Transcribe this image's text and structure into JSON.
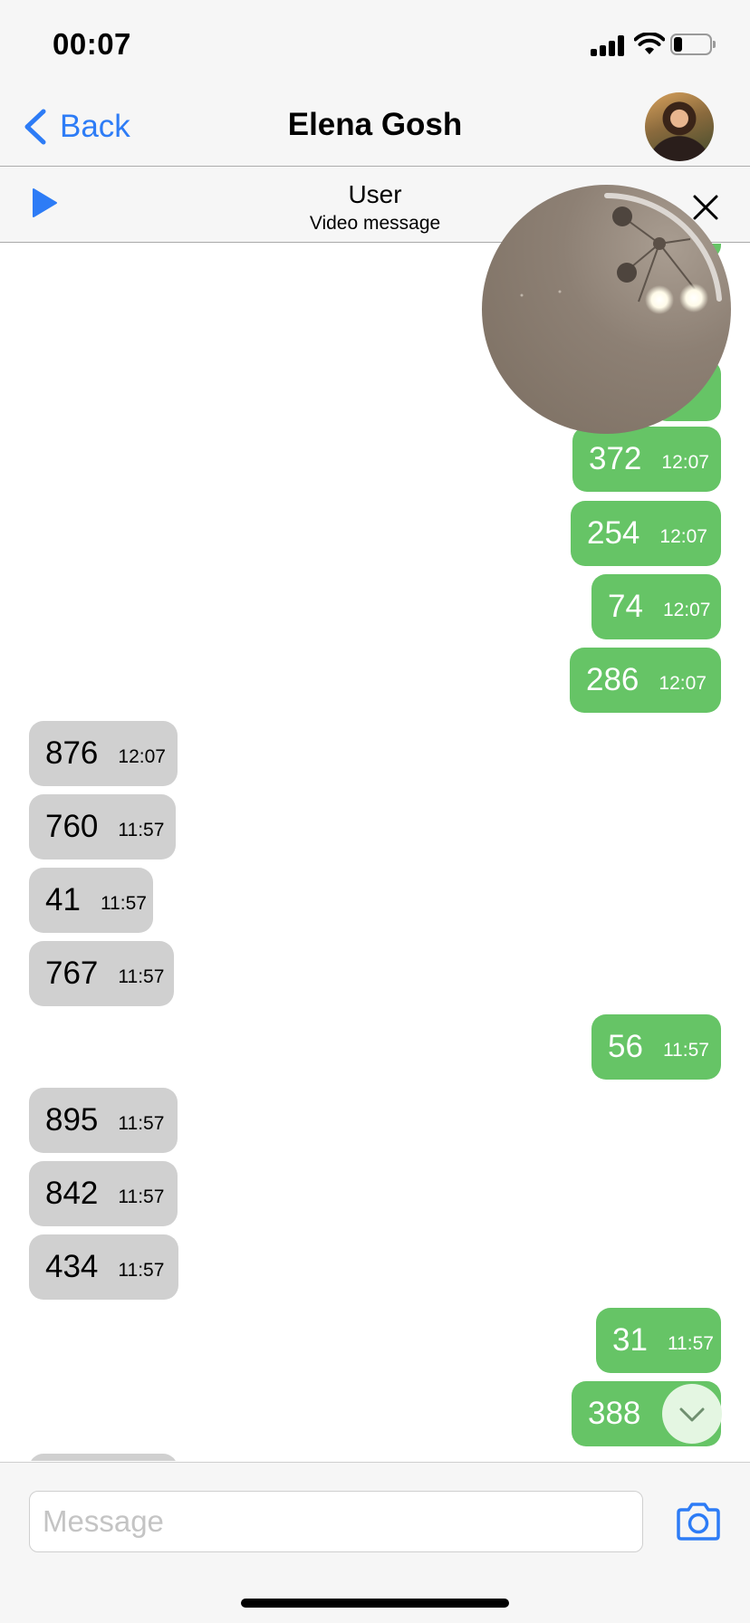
{
  "status_bar": {
    "time": "00:07"
  },
  "nav": {
    "back_label": "Back",
    "title": "Elena Gosh"
  },
  "media_bar": {
    "title": "User",
    "subtitle": "Video message"
  },
  "messages": [
    {
      "dir": "out",
      "text": "372",
      "time": "12:07"
    },
    {
      "dir": "out",
      "text": "254",
      "time": "12:07"
    },
    {
      "dir": "out",
      "text": "74",
      "time": "12:07"
    },
    {
      "dir": "out",
      "text": "286",
      "time": "12:07"
    },
    {
      "dir": "in",
      "text": "876",
      "time": "12:07"
    },
    {
      "dir": "in",
      "text": "760",
      "time": "11:57"
    },
    {
      "dir": "in",
      "text": "41",
      "time": "11:57"
    },
    {
      "dir": "in",
      "text": "767",
      "time": "11:57"
    },
    {
      "dir": "out",
      "text": "56",
      "time": "11:57"
    },
    {
      "dir": "in",
      "text": "895",
      "time": "11:57"
    },
    {
      "dir": "in",
      "text": "842",
      "time": "11:57"
    },
    {
      "dir": "in",
      "text": "434",
      "time": "11:57"
    },
    {
      "dir": "out",
      "text": "31",
      "time": "11:57"
    },
    {
      "dir": "out",
      "text": "388",
      "time": ""
    }
  ],
  "composer": {
    "placeholder": "Message"
  },
  "colors": {
    "accent": "#2d7cf6",
    "outgoing_bubble": "#66c466",
    "incoming_bubble": "#d0d0d0"
  }
}
